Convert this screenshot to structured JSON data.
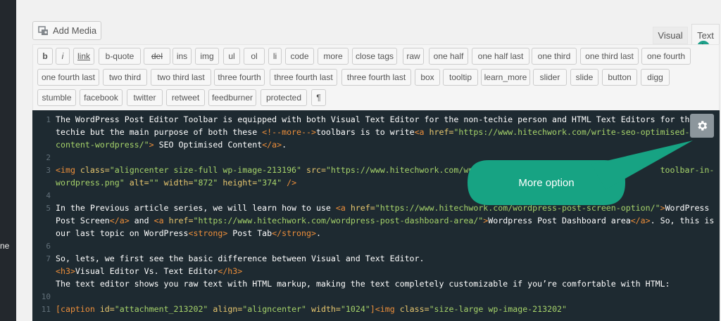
{
  "sidebar": {
    "fragment": "ne"
  },
  "media": {
    "add_media_label": "Add Media"
  },
  "tabs": {
    "visual": "Visual",
    "text": "Text"
  },
  "quicktags": [
    "b",
    "i",
    "link",
    "b-quote",
    "del",
    "ins",
    "img",
    "ul",
    "ol",
    "li",
    "code",
    "more",
    "close tags",
    "raw",
    "one half",
    "one half last",
    "one third",
    "one third last",
    "one fourth",
    "one fourth last",
    "two third",
    "two third last",
    "three fourth",
    "three fourth last",
    "three fourth last",
    "box",
    "tooltip",
    "learn_more",
    "slider",
    "slide",
    "button",
    "digg",
    "stumble",
    "facebook",
    "twitter",
    "retweet",
    "feedburner",
    "protected",
    "¶"
  ],
  "callout": {
    "label": "More option"
  },
  "gear": {
    "icon": "gear-icon"
  },
  "editor": {
    "lines": [
      {
        "num": "1",
        "tokens": [
          {
            "t": "The WordPress Post Editor Toolbar is equipped with both Visual Text Editor for the non-techie person and HTML Text Editors for the",
            "c": ""
          }
        ]
      },
      {
        "num": "",
        "tokens": [
          {
            "t": "techie but the main purpose of both these ",
            "c": ""
          },
          {
            "t": "<!--more-->",
            "c": "tag"
          },
          {
            "t": "toolbars is to write",
            "c": ""
          },
          {
            "t": "<a ",
            "c": "tag"
          },
          {
            "t": "href=",
            "c": "attr"
          },
          {
            "t": "\"https://www.hitechwork.com/write-seo-optimised-",
            "c": "str"
          }
        ]
      },
      {
        "num": "",
        "tokens": [
          {
            "t": "content-wordpress/\"",
            "c": "str"
          },
          {
            "t": "> ",
            "c": "tag"
          },
          {
            "t": "SEO Optimised Content",
            "c": ""
          },
          {
            "t": "</a>",
            "c": "tag"
          },
          {
            "t": ".",
            "c": ""
          }
        ]
      },
      {
        "num": "2",
        "tokens": []
      },
      {
        "num": "3",
        "tokens": [
          {
            "t": "<img ",
            "c": "tag"
          },
          {
            "t": "class=",
            "c": "attr"
          },
          {
            "t": "\"aligncenter size-full wp-image-213196\" ",
            "c": "str"
          },
          {
            "t": "src=",
            "c": "attr"
          },
          {
            "t": "\"https://www.hitechwork.com/wp-",
            "c": "str"
          },
          {
            "t": "                                     ",
            "c": ""
          },
          {
            "t": "toolbar-in-",
            "c": "str"
          }
        ]
      },
      {
        "num": "",
        "tokens": [
          {
            "t": "wordpress.png\" ",
            "c": "str"
          },
          {
            "t": "alt=",
            "c": "attr"
          },
          {
            "t": "\"\" ",
            "c": "str"
          },
          {
            "t": "width=",
            "c": "attr"
          },
          {
            "t": "\"872\" ",
            "c": "str"
          },
          {
            "t": "height=",
            "c": "attr"
          },
          {
            "t": "\"374\" ",
            "c": "str"
          },
          {
            "t": "/>",
            "c": "tag"
          }
        ]
      },
      {
        "num": "4",
        "tokens": []
      },
      {
        "num": "5",
        "tokens": [
          {
            "t": "In the Previous article series, we will learn how to use ",
            "c": ""
          },
          {
            "t": "<a ",
            "c": "tag"
          },
          {
            "t": "href=",
            "c": "attr"
          },
          {
            "t": "\"https://www.hitechwork.com/wordpress-post-screen-option/\"",
            "c": "str"
          },
          {
            "t": ">",
            "c": "tag"
          },
          {
            "t": "WordPress",
            "c": ""
          }
        ]
      },
      {
        "num": "",
        "tokens": [
          {
            "t": "Post Screen",
            "c": ""
          },
          {
            "t": "</a>",
            "c": "tag"
          },
          {
            "t": " and ",
            "c": ""
          },
          {
            "t": "<a ",
            "c": "tag"
          },
          {
            "t": "href=",
            "c": "attr"
          },
          {
            "t": "\"https://www.hitechwork.com/wordpress-post-dashboard-area/\"",
            "c": "str"
          },
          {
            "t": ">",
            "c": "tag"
          },
          {
            "t": "Wordpress Post Dashboard area",
            "c": ""
          },
          {
            "t": "</a>",
            "c": "tag"
          },
          {
            "t": ". So, this is",
            "c": ""
          }
        ]
      },
      {
        "num": "",
        "tokens": [
          {
            "t": "our last topic on WordPress",
            "c": ""
          },
          {
            "t": "<strong>",
            "c": "tag"
          },
          {
            "t": " Post Tab",
            "c": ""
          },
          {
            "t": "</strong>",
            "c": "tag"
          },
          {
            "t": ".",
            "c": ""
          }
        ]
      },
      {
        "num": "6",
        "tokens": []
      },
      {
        "num": "7",
        "tokens": [
          {
            "t": "So, lets, we first see the basic difference between Visual and Text Editor.",
            "c": ""
          }
        ]
      },
      {
        "num": "",
        "tokens": [
          {
            "t": "<h3>",
            "c": "tag"
          },
          {
            "t": "Visual Editor Vs. Text Editor",
            "c": ""
          },
          {
            "t": "</h3>",
            "c": "tag"
          }
        ]
      },
      {
        "num": "",
        "tokens": [
          {
            "t": "The text editor shows you raw text with HTML markup, making the text completely customizable if you’re comfortable with HTML:",
            "c": ""
          }
        ]
      },
      {
        "num": "10",
        "tokens": []
      },
      {
        "num": "11",
        "tokens": [
          {
            "t": "[caption ",
            "c": "tag"
          },
          {
            "t": "id=",
            "c": "attr"
          },
          {
            "t": "\"attachment_213202\" ",
            "c": "str"
          },
          {
            "t": "align=",
            "c": "attr"
          },
          {
            "t": "\"aligncenter\" ",
            "c": "str"
          },
          {
            "t": "width=",
            "c": "attr"
          },
          {
            "t": "\"1024\"",
            "c": "str"
          },
          {
            "t": "]<img ",
            "c": "tag"
          },
          {
            "t": "class=",
            "c": "attr"
          },
          {
            "t": "\"size-large wp-image-213202\"",
            "c": "str"
          }
        ]
      }
    ]
  }
}
